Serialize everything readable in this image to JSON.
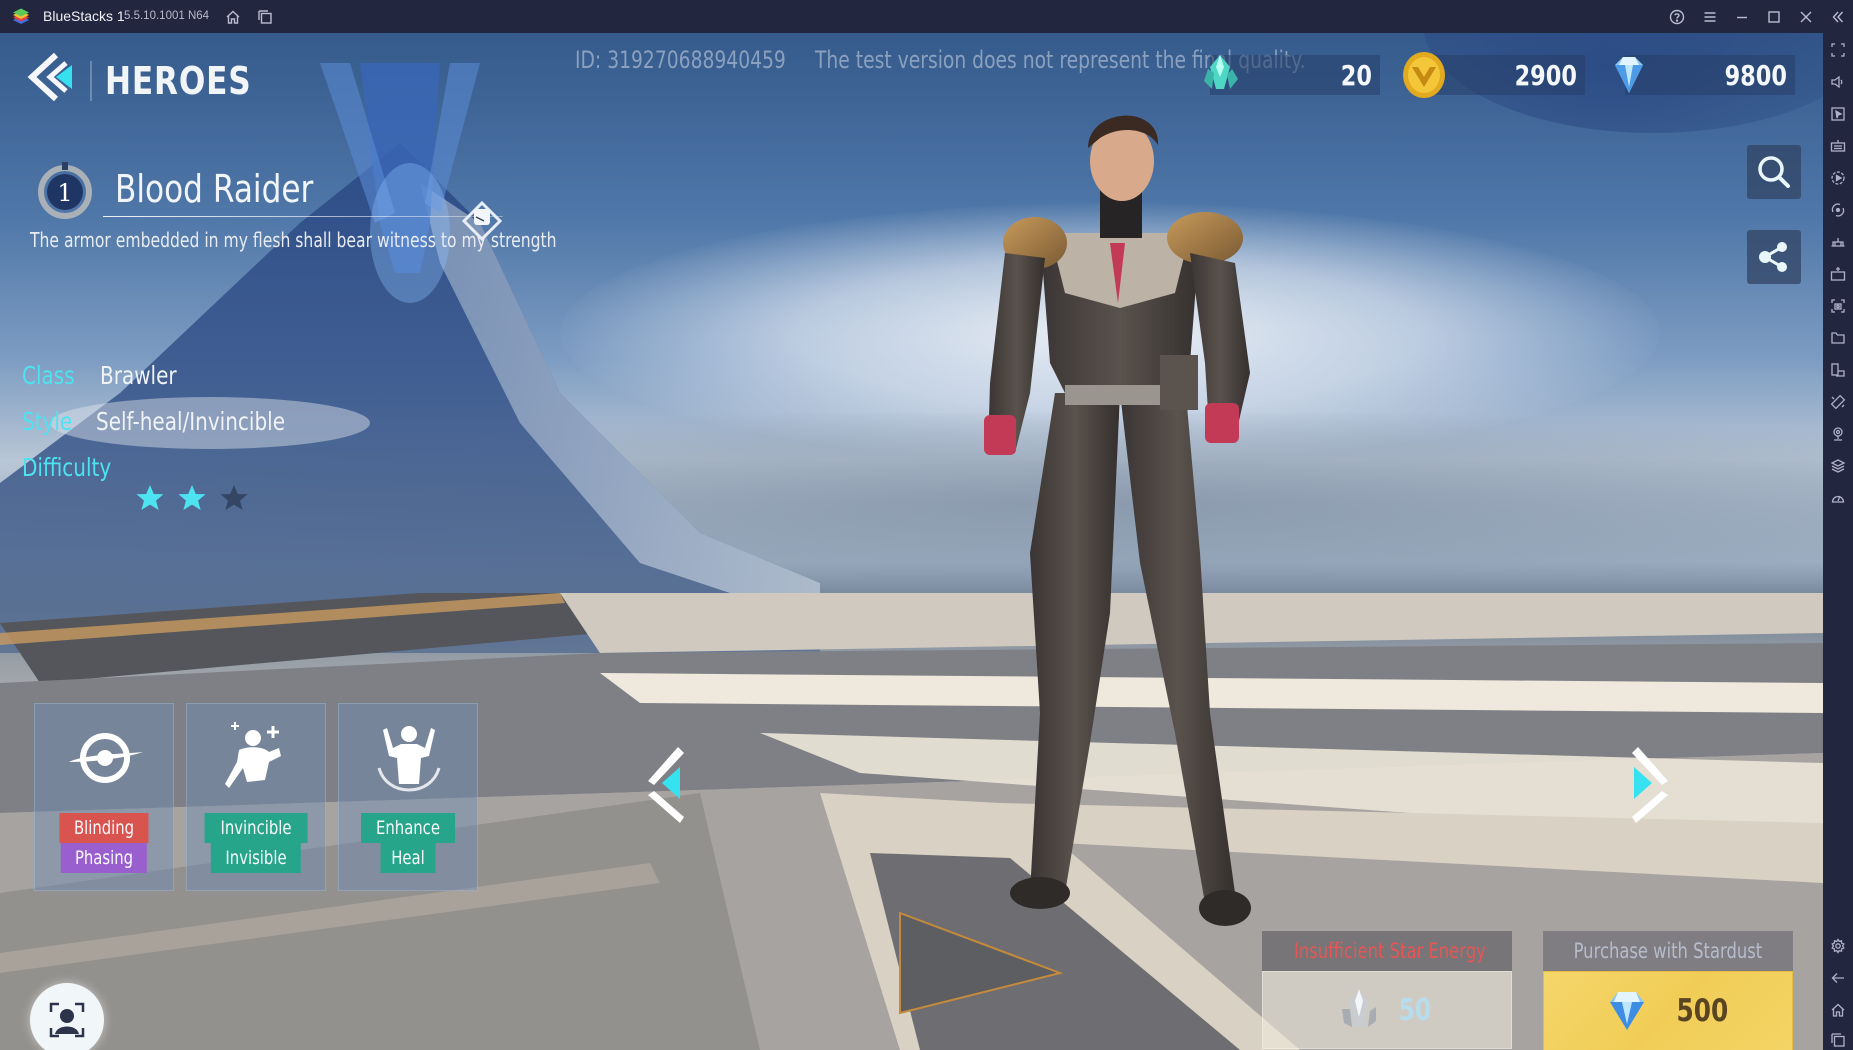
{
  "app": {
    "name": "BlueStacks 1",
    "version": "5.5.10.1001 N64",
    "titlebar_icons": [
      "home-icon",
      "multi-instance-icon",
      "help-icon",
      "menu-icon",
      "minimize-icon",
      "maximize-icon",
      "close-icon",
      "collapse-sidebar-icon"
    ]
  },
  "sidebar": {
    "top_items": [
      "fullscreen",
      "volume",
      "pointer",
      "keyboard-controls",
      "macro-recorder",
      "sync",
      "game-controls",
      "install-apk",
      "screenshot",
      "media-folder",
      "multi-instance",
      "rotate",
      "location",
      "layers",
      "eco-mode"
    ],
    "bottom_items": [
      "settings",
      "back",
      "home",
      "recent-apps"
    ]
  },
  "game": {
    "page_title": "HEROES",
    "user_id": "ID: 319270688940459",
    "disclaimer": "The test version does not represent the final quality.",
    "currencies": [
      {
        "name": "star-energy",
        "value": "20"
      },
      {
        "name": "gold",
        "value": "2900"
      },
      {
        "name": "diamond",
        "value": "9800"
      }
    ],
    "hero": {
      "rank": "1",
      "name": "Blood Raider",
      "tagline": "The armor embedded in my flesh shall bear witness to my strength",
      "attributes": [
        {
          "label": "Class",
          "value": "Brawler"
        },
        {
          "label": "Style",
          "value": "Self-heal/Invincible"
        },
        {
          "label": "Difficulty",
          "stars_filled": 2,
          "stars_total": 3
        }
      ]
    },
    "skills": [
      {
        "icon": "blinding-eye-icon",
        "tags": [
          {
            "text": "Blinding",
            "color": "#d9534f"
          },
          {
            "text": "Phasing",
            "color": "#9a5fcf"
          }
        ]
      },
      {
        "icon": "invincible-figure-icon",
        "tags": [
          {
            "text": "Invincible",
            "color": "#27a58a"
          },
          {
            "text": "Invisible",
            "color": "#27a58a"
          }
        ]
      },
      {
        "icon": "enhance-heal-icon",
        "tags": [
          {
            "text": "Enhance",
            "color": "#27a58a"
          },
          {
            "text": "Heal",
            "color": "#27a58a"
          }
        ]
      }
    ],
    "purchase": {
      "insufficient_label": "Insufficient Star Energy",
      "star_energy_cost": "50",
      "stardust_label": "Purchase with Stardust",
      "diamond_cost": "500"
    },
    "colors": {
      "accent_cyan": "#4de3f0",
      "buy_button": "#f3d260",
      "warning_red": "#e65656"
    }
  }
}
